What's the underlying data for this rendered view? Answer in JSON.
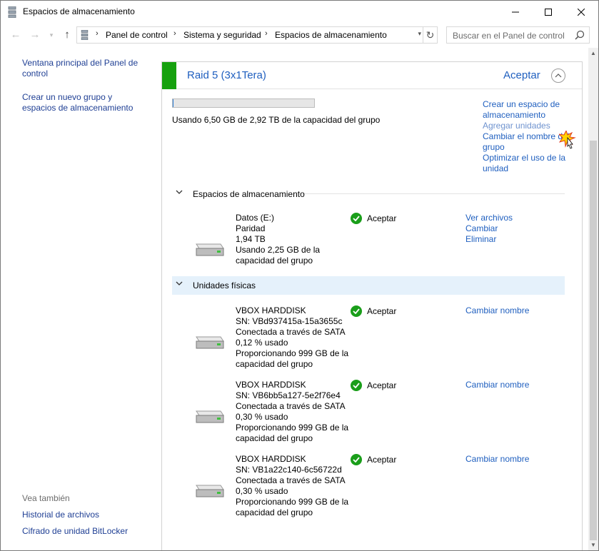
{
  "window": {
    "title": "Espacios de almacenamiento"
  },
  "address": {
    "crumbs": [
      "Panel de control",
      "Sistema y seguridad",
      "Espacios de almacenamiento"
    ],
    "search_placeholder": "Buscar en el Panel de control"
  },
  "sidebar": {
    "links": [
      "Ventana principal del Panel de control",
      "Crear un nuevo grupo y espacios de almacenamiento"
    ],
    "see_also_label": "Vea también",
    "see_also": [
      "Historial de archivos",
      "Cifrado de unidad BitLocker"
    ]
  },
  "pool": {
    "name": "Raid 5 (3x1Tera)",
    "status": "Aceptar",
    "usage_text": "Usando 6,50 GB de 2,92 TB de la capacidad del grupo",
    "usage_fraction": 0.002,
    "actions": [
      "Crear un espacio de almacenamiento",
      "Agregar unidades",
      "Cambiar el nombre del grupo",
      "Optimizar el uso de la unidad"
    ]
  },
  "spaces": {
    "header": "Espacios de almacenamiento",
    "items": [
      {
        "lines": [
          "Datos (E:)",
          "Paridad",
          "1,94 TB",
          "Usando 2,25 GB de la capacidad del grupo"
        ],
        "status": "Aceptar",
        "links": [
          "Ver archivos",
          "Cambiar",
          "Eliminar"
        ]
      }
    ]
  },
  "physical": {
    "header": "Unidades físicas",
    "items": [
      {
        "lines": [
          "VBOX HARDDISK",
          "SN: VBd937415a-15a3655c",
          "Conectada a través de SATA",
          "0,12 % usado",
          "Proporcionando 999 GB de la capacidad del grupo"
        ],
        "status": "Aceptar",
        "link": "Cambiar nombre"
      },
      {
        "lines": [
          "VBOX HARDDISK",
          "SN: VB6bb5a127-5e2f76e4",
          "Conectada a través de SATA",
          "0,30 % usado",
          "Proporcionando 999 GB de la capacidad del grupo"
        ],
        "status": "Aceptar",
        "link": "Cambiar nombre"
      },
      {
        "lines": [
          "VBOX HARDDISK",
          "SN: VB1a22c140-6c56722d",
          "Conectada a través de SATA",
          "0,30 % usado",
          "Proporcionando 999 GB de la capacidad del grupo"
        ],
        "status": "Aceptar",
        "link": "Cambiar nombre"
      }
    ]
  },
  "colors": {
    "link": "#1f5fbf",
    "accent_green": "#16a10e",
    "selection": "#e5f1fb"
  }
}
